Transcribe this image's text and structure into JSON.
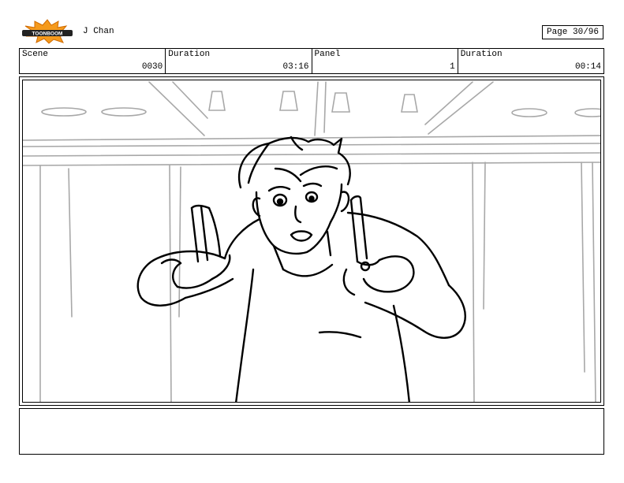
{
  "header": {
    "logo_text": "TOONBOOM",
    "author": "J Chan",
    "page": "Page 30/96"
  },
  "fields": [
    {
      "label": "Scene",
      "value": "0030"
    },
    {
      "label": "Duration",
      "value": "03:16"
    },
    {
      "label": "Panel",
      "value": "1"
    },
    {
      "label": "Duration",
      "value": "00:14"
    }
  ],
  "panel": {
    "image": "storyboard-sketch-character-pointing"
  },
  "notes": {
    "text": ""
  }
}
